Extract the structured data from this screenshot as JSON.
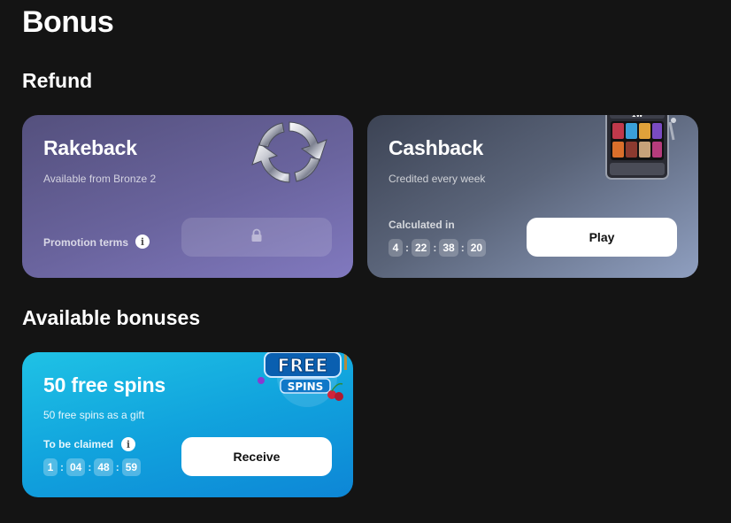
{
  "page": {
    "title": "Bonus"
  },
  "refund": {
    "title": "Refund",
    "rakeback": {
      "title": "Rakeback",
      "subtitle": "Available from Bronze 2",
      "terms_label": "Promotion terms",
      "info_glyph": "i",
      "icon": "refresh-arrows-icon",
      "button_state": "locked",
      "lock_icon": "lock-icon"
    },
    "cashback": {
      "title": "Cashback",
      "subtitle": "Credited every week",
      "timer_label": "Calculated in",
      "timer": [
        "4",
        "22",
        "38",
        "20"
      ],
      "button_label": "Play",
      "icon": "slot-machine-icon"
    }
  },
  "available": {
    "title": "Available bonuses",
    "free_spins": {
      "title": "50 free spins",
      "subtitle": "50 free spins as a gift",
      "timer_label": "To be claimed",
      "info_glyph": "i",
      "timer": [
        "1",
        "04",
        "48",
        "59"
      ],
      "button_label": "Receive",
      "icon": "free-spins-badge-icon",
      "badge_text_top": "FREE",
      "badge_text_bottom": "SPINS"
    }
  },
  "colors": {
    "background": "#141414",
    "rakeback_card": "#6a649e",
    "cashback_card": "#5a6479",
    "free_spins_card": "#11a3dd",
    "button": "#ffffff"
  }
}
